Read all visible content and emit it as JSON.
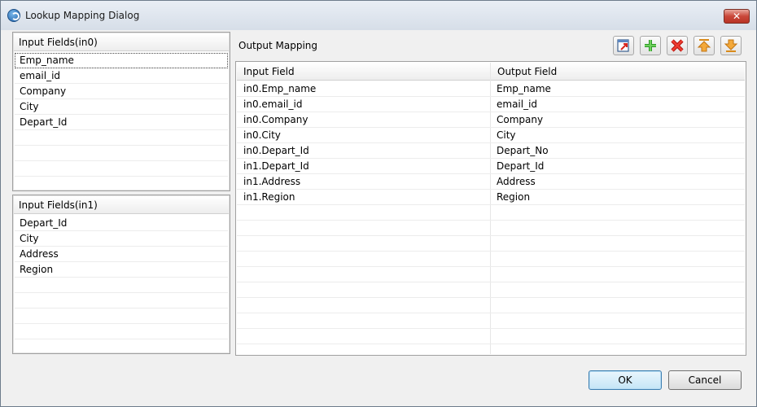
{
  "window": {
    "title": "Lookup Mapping Dialog",
    "close_label": "✕"
  },
  "input_in0": {
    "header": "Input Fields(in0)",
    "items": [
      "Emp_name",
      "email_id",
      "Company",
      "City",
      "Depart_Id"
    ]
  },
  "input_in1": {
    "header": "Input Fields(in1)",
    "items": [
      "Depart_Id",
      "City",
      "Address",
      "Region"
    ]
  },
  "output_mapping": {
    "label": "Output Mapping",
    "toolbar": [
      "export-icon",
      "add-icon",
      "delete-icon",
      "move-up-icon",
      "move-down-icon"
    ],
    "columns": [
      "Input Field",
      "Output Field"
    ],
    "rows": [
      [
        "in0.Emp_name",
        "Emp_name"
      ],
      [
        "in0.email_id",
        "email_id"
      ],
      [
        "in0.Company",
        "Company"
      ],
      [
        "in0.City",
        "City"
      ],
      [
        "in0.Depart_Id",
        "Depart_No"
      ],
      [
        "in1.Depart_Id",
        "Depart_Id"
      ],
      [
        "in1.Address",
        "Address"
      ],
      [
        "in1.Region",
        "Region"
      ]
    ]
  },
  "buttons": {
    "ok": "OK",
    "cancel": "Cancel"
  }
}
